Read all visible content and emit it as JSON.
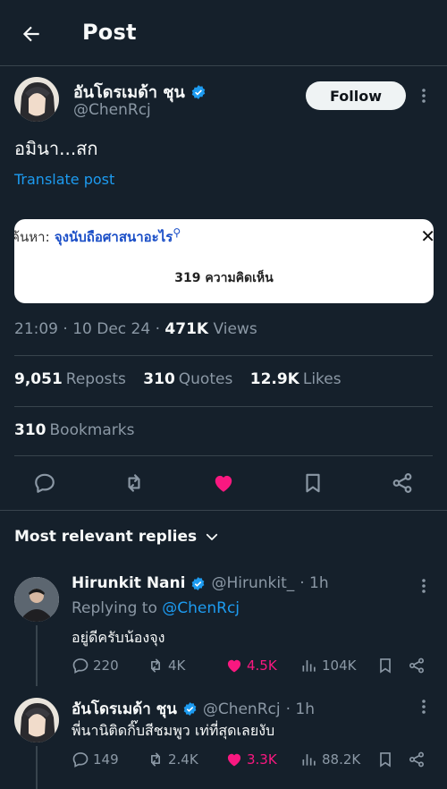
{
  "header": {
    "title": "Post",
    "back_icon": "arrow-left-icon"
  },
  "post": {
    "author_name": "อันโดรเมด้า ชุน",
    "author_handle": "@ChenRcj",
    "follow_label": "Follow",
    "text": "อมินา...สก",
    "translate_label": "Translate post",
    "media": {
      "search_label": "ค้นหา:",
      "search_query": "จุงนับถือศาสนาอะไร",
      "close_glyph": "✕",
      "comments_label": "319 ความคิดเห็น"
    },
    "time": "21:09",
    "date": "10 Dec 24",
    "views_count": "471K",
    "views_label": "Views",
    "reposts_count": "9,051",
    "reposts_label": "Reposts",
    "quotes_count": "310",
    "quotes_label": "Quotes",
    "likes_count": "12.9K",
    "likes_label": "Likes",
    "bookmarks_count": "310",
    "bookmarks_label": "Bookmarks"
  },
  "replies_filter": {
    "label": "Most relevant replies"
  },
  "replies": [
    {
      "name": "Hirunkit Nani",
      "handle": "@Hirunkit_",
      "time": "· 1h",
      "replying_prefix": "Replying to",
      "replying_to": "@ChenRcj",
      "text": "อยู่ดีครับน้องจุง",
      "comments": "220",
      "reposts": "4K",
      "likes": "4.5K",
      "views": "104K"
    },
    {
      "name": "อันโดรเมด้า ชุน",
      "handle": "@ChenRcj",
      "time": "· 1h",
      "text": "พี่นานิติดกิ๊บสีชมพูว เท่ที่สุดเลยงับ",
      "comments": "149",
      "reposts": "2.4K",
      "likes": "3.3K",
      "views": "88.2K"
    }
  ],
  "colors": {
    "background": "#15202b",
    "accent": "#1d9bf0",
    "like": "#f91880",
    "muted": "#8b98a5"
  }
}
